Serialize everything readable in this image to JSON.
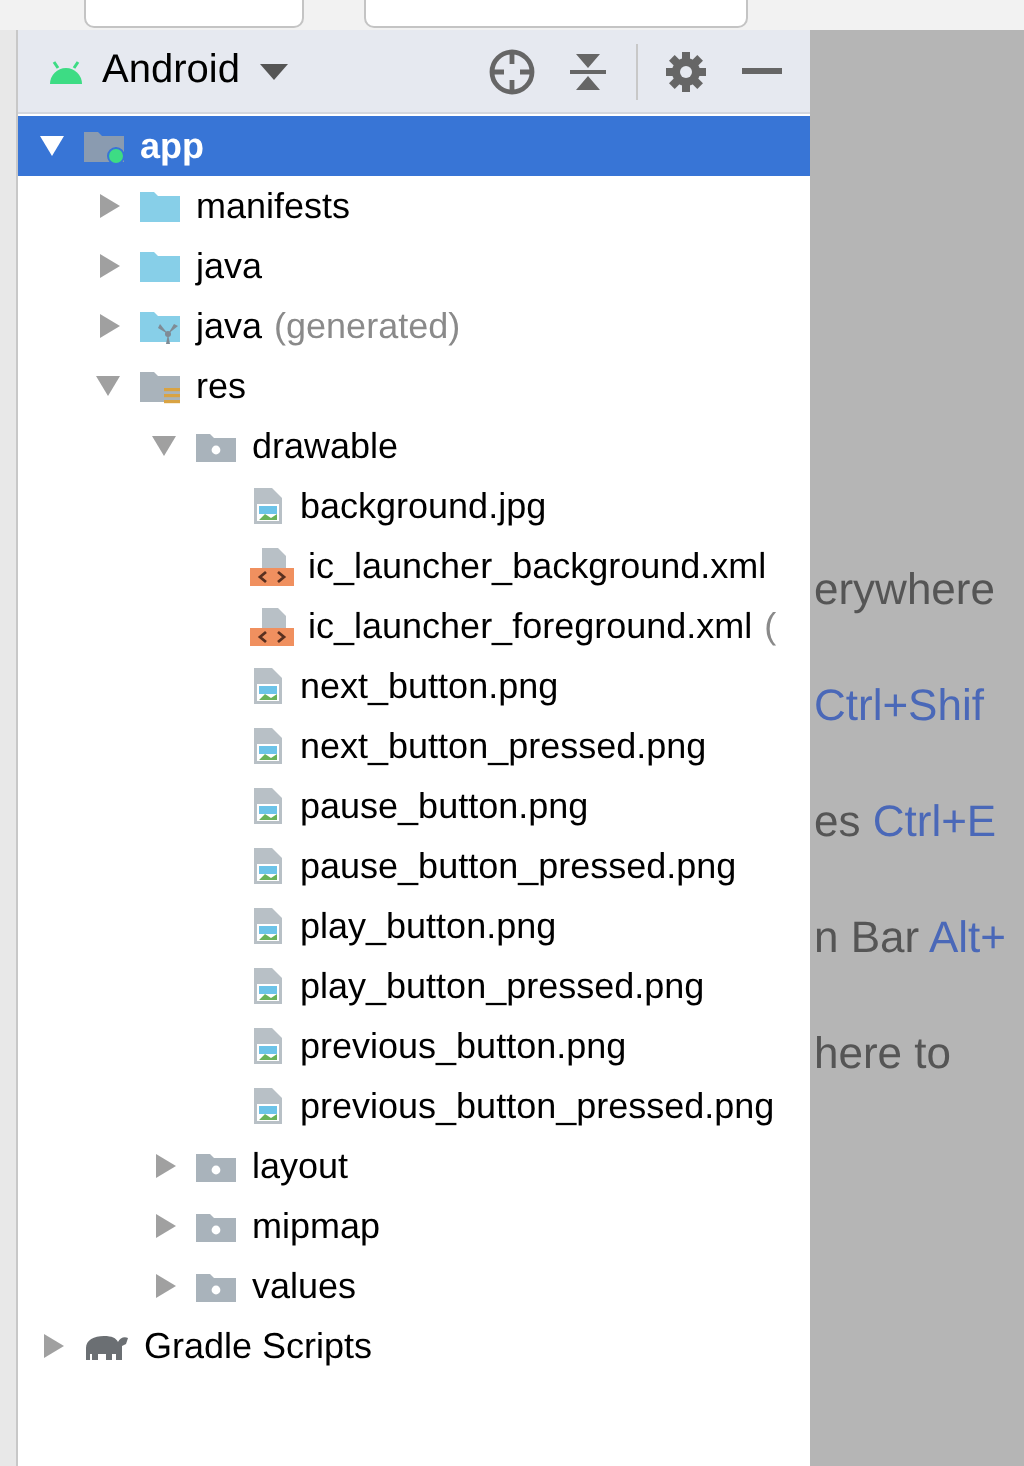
{
  "project_view": {
    "title": "Android",
    "tree": [
      {
        "label": "app",
        "kind": "module",
        "expanded": true,
        "selected": true,
        "children": [
          {
            "label": "manifests",
            "kind": "folder",
            "expanded": false,
            "selected": false
          },
          {
            "label": "java",
            "kind": "folder",
            "expanded": false,
            "selected": false
          },
          {
            "label": "java",
            "note": "(generated)",
            "kind": "generated-folder",
            "expanded": false,
            "selected": false
          },
          {
            "label": "res",
            "kind": "res-folder",
            "expanded": true,
            "selected": false,
            "children": [
              {
                "label": "drawable",
                "kind": "res-subfolder",
                "expanded": true,
                "selected": false,
                "children": [
                  {
                    "label": "background.jpg",
                    "kind": "image-file",
                    "selected": false
                  },
                  {
                    "label": "ic_launcher_background.xml",
                    "kind": "xml-file",
                    "selected": false
                  },
                  {
                    "label": "ic_launcher_foreground.xml",
                    "note": "(",
                    "kind": "xml-file",
                    "selected": false
                  },
                  {
                    "label": "next_button.png",
                    "kind": "image-file",
                    "selected": false
                  },
                  {
                    "label": "next_button_pressed.png",
                    "kind": "image-file",
                    "selected": false
                  },
                  {
                    "label": "pause_button.png",
                    "kind": "image-file",
                    "selected": false
                  },
                  {
                    "label": "pause_button_pressed.png",
                    "kind": "image-file",
                    "selected": false
                  },
                  {
                    "label": "play_button.png",
                    "kind": "image-file",
                    "selected": false
                  },
                  {
                    "label": "play_button_pressed.png",
                    "kind": "image-file",
                    "selected": false
                  },
                  {
                    "label": "previous_button.png",
                    "kind": "image-file",
                    "selected": false
                  },
                  {
                    "label": "previous_button_pressed.png",
                    "kind": "image-file",
                    "selected": false
                  }
                ]
              },
              {
                "label": "layout",
                "kind": "res-subfolder",
                "expanded": false,
                "selected": false
              },
              {
                "label": "mipmap",
                "kind": "res-subfolder",
                "expanded": false,
                "selected": false
              },
              {
                "label": "values",
                "kind": "res-subfolder",
                "expanded": false,
                "selected": false
              }
            ]
          }
        ]
      },
      {
        "label": "Gradle Scripts",
        "kind": "gradle",
        "expanded": false,
        "selected": false
      }
    ]
  },
  "editor_hints": [
    {
      "text": "erywhere"
    },
    {
      "shortcut": "Ctrl+Shif"
    },
    {
      "text": "es",
      "shortcut": "Ctrl+E"
    },
    {
      "text": "n Bar",
      "shortcut": "Alt+"
    },
    {
      "text": "here to"
    }
  ]
}
